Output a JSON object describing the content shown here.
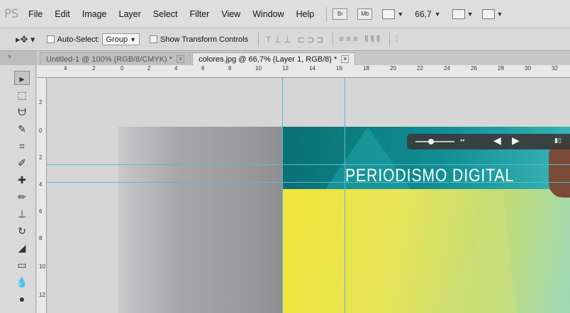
{
  "menubar": {
    "logo": "PS",
    "items": [
      "File",
      "Edit",
      "Image",
      "Layer",
      "Select",
      "Filter",
      "View",
      "Window",
      "Help"
    ],
    "bridge_label": "Br",
    "minibridge_label": "Mb",
    "zoom": "66,7"
  },
  "optionsbar": {
    "auto_select_label": "Auto-Select:",
    "auto_select_value": "Group",
    "show_transform_label": "Show Transform Controls"
  },
  "tabs": [
    {
      "label": "Untitled-1 @ 100% (RGB/8/CMYK) *",
      "active": false
    },
    {
      "label": "colores.jpg @ 66,7% (Layer 1, RGB/8) *",
      "active": true
    }
  ],
  "ruler": {
    "h_ticks": [
      "4",
      "2",
      "0",
      "2",
      "4",
      "6",
      "8",
      "10",
      "12",
      "14",
      "16",
      "18",
      "20",
      "22",
      "24",
      "26",
      "28",
      "30",
      "32"
    ],
    "v_ticks": [
      "2",
      "0",
      "2",
      "4",
      "6",
      "8",
      "10",
      "12"
    ]
  },
  "artwork": {
    "title": "PERIODISMO DIGITAL"
  },
  "colors": {
    "guide": "#5fb6d6",
    "teal": "#0f8f93",
    "yellow": "#f2e63a"
  }
}
